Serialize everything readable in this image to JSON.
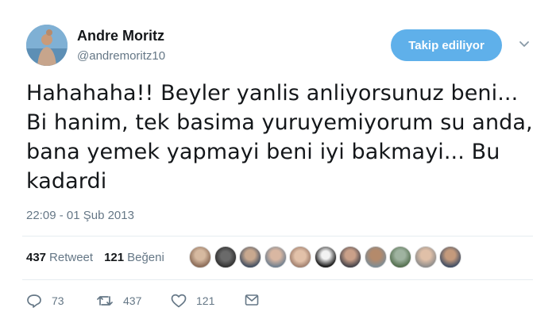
{
  "author": {
    "name": "Andre Moritz",
    "handle": "@andremoritz10"
  },
  "follow_button_label": "Takip ediliyor",
  "tweet": {
    "text": "Hahahaha!! Beyler yanlis anliyorsunuz beni... Bi hanim, tek basima yuruyemiyorum su anda, bana yemek yapmayi beni iyi bakmayi... Bu kadardi",
    "timestamp": "22:09 - 01 Şub 2013"
  },
  "stats": {
    "retweets_count": "437",
    "retweets_label": "Retweet",
    "likes_count": "121",
    "likes_label": "Beğeni"
  },
  "actions": {
    "reply_count": "73",
    "retweet_count": "437",
    "like_count": "121"
  },
  "colors": {
    "accent": "#5fb0ea",
    "secondary_text": "#657786"
  }
}
